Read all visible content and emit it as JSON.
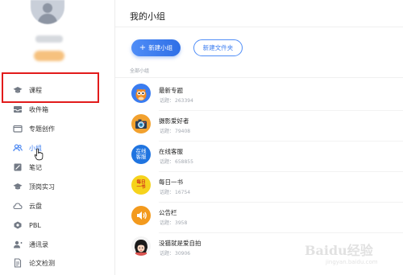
{
  "sidebar": {
    "items": [
      {
        "label": "课程",
        "icon": "graduation-cap-icon"
      },
      {
        "label": "收件箱",
        "icon": "inbox-icon"
      },
      {
        "label": "专题创作",
        "icon": "folder-icon"
      },
      {
        "label": "小组",
        "icon": "group-icon"
      },
      {
        "label": "笔记",
        "icon": "note-icon"
      },
      {
        "label": "顶岗实习",
        "icon": "internship-icon"
      },
      {
        "label": "云盘",
        "icon": "cloud-icon"
      },
      {
        "label": "PBL",
        "icon": "pbl-icon"
      },
      {
        "label": "通讯录",
        "icon": "contacts-icon"
      },
      {
        "label": "论文检测",
        "icon": "document-check-icon"
      }
    ],
    "active_item": "小组"
  },
  "main": {
    "title": "我的小组",
    "new_group_button": "新建小组",
    "new_folder_button": "新建文件夹",
    "section_label": "全部小组",
    "groups": [
      {
        "name": "最新专题",
        "count_label": "话题：",
        "count": "263394",
        "icon": "owl-icon"
      },
      {
        "name": "摄影爱好者",
        "count_label": "话题：",
        "count": "79408",
        "icon": "camera-icon"
      },
      {
        "name": "在线客服",
        "count_label": "话题：",
        "count": "658855",
        "icon_text": [
          "在线",
          "客服"
        ],
        "icon": "online-service-icon"
      },
      {
        "name": "每日一书",
        "count_label": "话题：",
        "count": "16754",
        "icon_text": [
          "每日",
          "一书"
        ],
        "icon": "book-icon"
      },
      {
        "name": "公告栏",
        "count_label": "话题：",
        "count": "3958",
        "icon": "speaker-icon"
      },
      {
        "name": "没猫就是爱自拍",
        "count_label": "话题：",
        "count": "30906",
        "icon": "selfie-icon"
      }
    ]
  },
  "watermark": {
    "main": "Baidu经验",
    "sub": "jingyan.baidu.com"
  },
  "colors": {
    "accent": "#3a7cf0",
    "highlight": "#e21b1b"
  }
}
